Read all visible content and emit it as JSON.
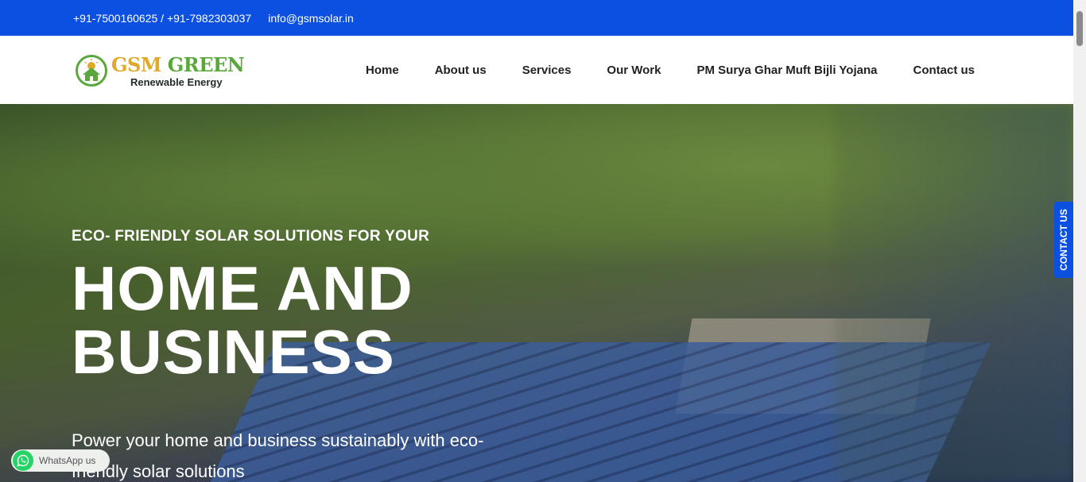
{
  "topbar": {
    "phone": "+91-7500160625 / +91-7982303037",
    "email": "info@gsmsolar.in"
  },
  "logo": {
    "title_part1": "GSM ",
    "title_part2": "GREEN",
    "subtitle": "Renewable Energy"
  },
  "nav": {
    "items": [
      {
        "label": "Home"
      },
      {
        "label": "About us"
      },
      {
        "label": "Services"
      },
      {
        "label": "Our Work"
      },
      {
        "label": "PM Surya Ghar Muft Bijli Yojana"
      },
      {
        "label": "Contact us"
      }
    ]
  },
  "hero": {
    "eyebrow": "ECO- FRIENDLY SOLAR SOLUTIONS FOR YOUR",
    "title": "HOME AND\nBUSINESS",
    "description": "Power your home and business sustainably with eco-friendly solar solutions"
  },
  "contact_tab": {
    "label": "CONTACT US"
  },
  "whatsapp": {
    "label": "WhatsApp us",
    "icon": "whatsapp-icon"
  },
  "colors": {
    "brand_blue": "#0b50e0",
    "logo_green": "#5aa83c",
    "logo_gold": "#e0a92a",
    "whatsapp_green": "#25d366"
  }
}
